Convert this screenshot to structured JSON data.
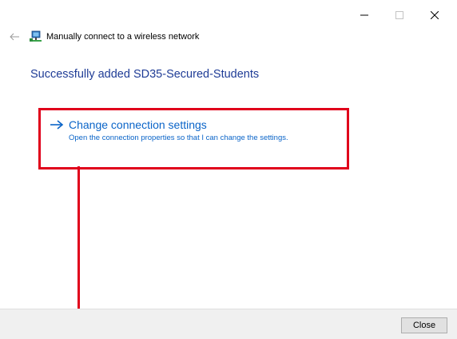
{
  "window": {
    "title": "Manually connect to a wireless network"
  },
  "main": {
    "heading": "Successfully added SD35-Secured-Students"
  },
  "command_link": {
    "title": "Change connection settings",
    "description": "Open the connection properties so that I can change the settings."
  },
  "footer": {
    "close_label": "Close"
  },
  "icons": {
    "back": "back-arrow-icon",
    "network": "network-icon",
    "link_arrow": "right-arrow-icon",
    "minimize": "minimize-icon",
    "maximize": "maximize-icon",
    "close": "close-icon"
  },
  "colors": {
    "heading": "#1f3c96",
    "link": "#0a64c8",
    "annotation": "#e0001b",
    "footer_bg": "#f0f0f0"
  }
}
